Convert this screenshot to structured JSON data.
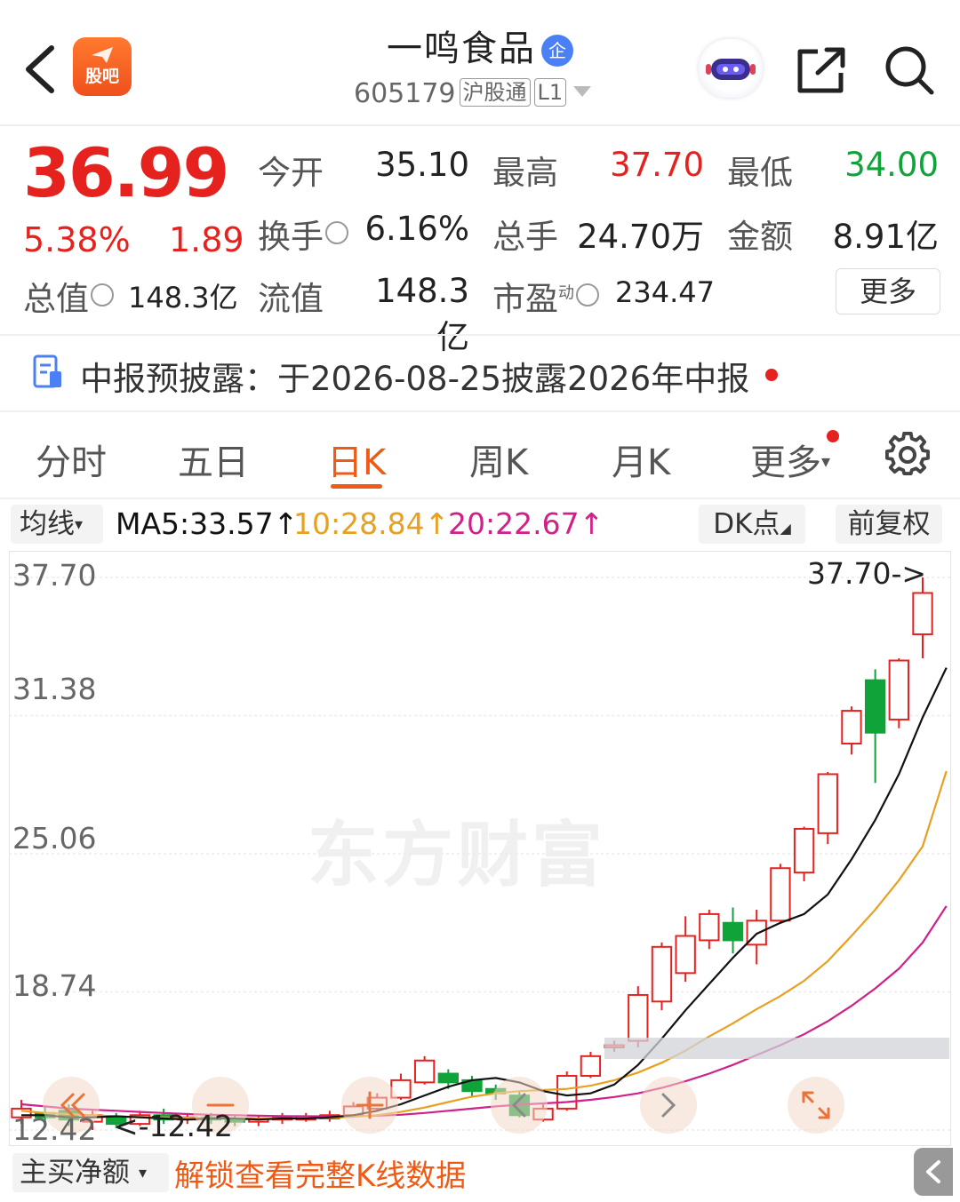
{
  "header": {
    "app_logo_label": "股吧",
    "stock_name": "一鸣食品",
    "company_badge": "企",
    "stock_code": "605179",
    "market_tag": "沪股通",
    "level_tag": "L1"
  },
  "quote": {
    "price": "36.99",
    "change_pct": "5.38%",
    "change_amount": "1.89",
    "open_label": "今开",
    "open_value": "35.10",
    "high_label": "最高",
    "high_value": "37.70",
    "low_label": "最低",
    "low_value": "34.00",
    "turnover_label": "换手",
    "turnover_value": "6.16%",
    "volume_label": "总手",
    "volume_value": "24.70万",
    "amount_label": "金额",
    "amount_value": "8.91亿",
    "total_cap_label": "总值",
    "total_cap_value": "148.3亿",
    "float_cap_label": "流值",
    "float_cap_value": "148.3亿",
    "pe_label": "市盈",
    "pe_sup": "动",
    "pe_value": "234.47",
    "more_label": "更多",
    "up_color": "#e6221f",
    "down_color": "#0fa33a"
  },
  "notice": {
    "text": "中报预披露：于2026-08-25披露2026年中报"
  },
  "tabs": [
    {
      "label": "分时"
    },
    {
      "label": "五日"
    },
    {
      "label": "日K",
      "active": true
    },
    {
      "label": "周K"
    },
    {
      "label": "月K"
    },
    {
      "label": "更多"
    }
  ],
  "ma_bar": {
    "selector_label": "均线",
    "ma5": "MA5:33.57",
    "ma10": "10:28.84",
    "ma20": "20:22.67",
    "arrow": "↑",
    "dk_label": "DK点",
    "adjust_label": "前复权",
    "ma5_color": "#111111",
    "ma10_color": "#e8a020",
    "ma20_color": "#d0208a"
  },
  "chart_data": {
    "type": "candlestick",
    "y_ticks": [
      "37.70",
      "31.38",
      "25.06",
      "18.74",
      "12.42"
    ],
    "ylim": [
      12.42,
      37.7
    ],
    "max_annotation": "37.70->",
    "min_annotation": "<-12.42",
    "watermark": "东方财富",
    "candles": [
      {
        "o": 13.0,
        "c": 13.4,
        "h": 13.8,
        "l": 12.7
      },
      {
        "o": 13.2,
        "c": 13.0,
        "h": 13.5,
        "l": 12.8
      },
      {
        "o": 13.3,
        "c": 12.9,
        "h": 13.6,
        "l": 12.6
      },
      {
        "o": 12.8,
        "c": 13.1,
        "h": 13.3,
        "l": 12.42
      },
      {
        "o": 13.0,
        "c": 12.7,
        "h": 13.2,
        "l": 12.5
      },
      {
        "o": 12.7,
        "c": 13.1,
        "h": 13.3,
        "l": 12.6
      },
      {
        "o": 13.1,
        "c": 12.9,
        "h": 13.4,
        "l": 12.7
      },
      {
        "o": 12.9,
        "c": 13.0,
        "h": 13.2,
        "l": 12.7
      },
      {
        "o": 13.0,
        "c": 12.9,
        "h": 13.2,
        "l": 12.7
      },
      {
        "o": 12.9,
        "c": 12.8,
        "h": 13.1,
        "l": 12.6
      },
      {
        "o": 12.8,
        "c": 12.95,
        "h": 13.1,
        "l": 12.6
      },
      {
        "o": 12.9,
        "c": 13.0,
        "h": 13.2,
        "l": 12.7
      },
      {
        "o": 12.9,
        "c": 13.05,
        "h": 13.2,
        "l": 12.8
      },
      {
        "o": 12.95,
        "c": 13.1,
        "h": 13.3,
        "l": 12.8
      },
      {
        "o": 13.1,
        "c": 13.5,
        "h": 13.7,
        "l": 13.0
      },
      {
        "o": 13.4,
        "c": 13.9,
        "h": 14.1,
        "l": 13.3
      },
      {
        "o": 13.9,
        "c": 14.7,
        "h": 15.0,
        "l": 13.8
      },
      {
        "o": 14.6,
        "c": 15.6,
        "h": 15.8,
        "l": 14.5
      },
      {
        "o": 15.0,
        "c": 14.6,
        "h": 15.2,
        "l": 14.3
      },
      {
        "o": 14.7,
        "c": 14.2,
        "h": 14.9,
        "l": 13.9
      },
      {
        "o": 14.3,
        "c": 14.1,
        "h": 14.5,
        "l": 13.8
      },
      {
        "o": 14.0,
        "c": 13.1,
        "h": 14.2,
        "l": 13.0
      },
      {
        "o": 12.9,
        "c": 13.4,
        "h": 13.6,
        "l": 12.8
      },
      {
        "o": 13.4,
        "c": 14.9,
        "h": 15.1,
        "l": 13.3
      },
      {
        "o": 14.9,
        "c": 15.8,
        "h": 16.0,
        "l": 14.8
      },
      {
        "o": 16.2,
        "c": 16.3,
        "h": 16.5,
        "l": 16.0
      },
      {
        "o": 16.5,
        "c": 18.6,
        "h": 19.0,
        "l": 16.2
      },
      {
        "o": 18.3,
        "c": 20.8,
        "h": 21.0,
        "l": 17.9
      },
      {
        "o": 19.6,
        "c": 21.3,
        "h": 22.2,
        "l": 19.2
      },
      {
        "o": 21.1,
        "c": 22.3,
        "h": 22.5,
        "l": 20.7
      },
      {
        "o": 21.9,
        "c": 21.1,
        "h": 22.6,
        "l": 20.5
      },
      {
        "o": 20.9,
        "c": 22.0,
        "h": 22.5,
        "l": 20.0
      },
      {
        "o": 22.0,
        "c": 24.4,
        "h": 24.6,
        "l": 21.9
      },
      {
        "o": 24.2,
        "c": 26.2,
        "h": 26.3,
        "l": 23.8
      },
      {
        "o": 26.0,
        "c": 28.7,
        "h": 28.8,
        "l": 25.5
      },
      {
        "o": 30.1,
        "c": 31.6,
        "h": 31.8,
        "l": 29.6
      },
      {
        "o": 33.0,
        "c": 30.6,
        "h": 33.5,
        "l": 28.3
      },
      {
        "o": 31.2,
        "c": 33.9,
        "h": 34.0,
        "l": 30.8
      },
      {
        "o": 35.1,
        "c": 36.99,
        "h": 37.7,
        "l": 34.0
      }
    ],
    "ma5": [
      13.1,
      13.1,
      13.0,
      13.0,
      13.05,
      13.0,
      12.95,
      12.9,
      12.95,
      12.95,
      12.9,
      12.95,
      12.95,
      13.0,
      13.1,
      13.3,
      13.6,
      14.0,
      14.4,
      14.7,
      14.8,
      14.6,
      14.2,
      14.0,
      14.1,
      14.5,
      15.4,
      16.6,
      17.9,
      19.1,
      20.3,
      21.4,
      21.9,
      22.3,
      23.2,
      24.8,
      26.6,
      28.7,
      31.3,
      33.57
    ],
    "ma10": [
      13.3,
      13.2,
      13.15,
      13.1,
      13.05,
      13.0,
      13.0,
      12.98,
      12.97,
      12.96,
      12.95,
      12.95,
      12.96,
      12.98,
      13.03,
      13.1,
      13.25,
      13.45,
      13.7,
      13.95,
      14.1,
      14.2,
      14.25,
      14.3,
      14.45,
      14.7,
      15.05,
      15.5,
      16.05,
      16.7,
      17.3,
      17.95,
      18.55,
      19.25,
      20.15,
      21.3,
      22.5,
      23.85,
      25.4,
      28.84
    ],
    "ma20": [
      13.6,
      13.5,
      13.4,
      13.35,
      13.3,
      13.25,
      13.2,
      13.15,
      13.12,
      13.1,
      13.08,
      13.06,
      13.05,
      13.05,
      13.06,
      13.08,
      13.12,
      13.2,
      13.3,
      13.4,
      13.5,
      13.58,
      13.64,
      13.7,
      13.8,
      13.93,
      14.1,
      14.35,
      14.65,
      15.0,
      15.4,
      15.85,
      16.3,
      16.8,
      17.4,
      18.1,
      18.9,
      19.8,
      21.0,
      22.67
    ]
  },
  "bottom": {
    "selector_label": "主买净额",
    "unlock_text": "解锁查看完整K线数据"
  }
}
